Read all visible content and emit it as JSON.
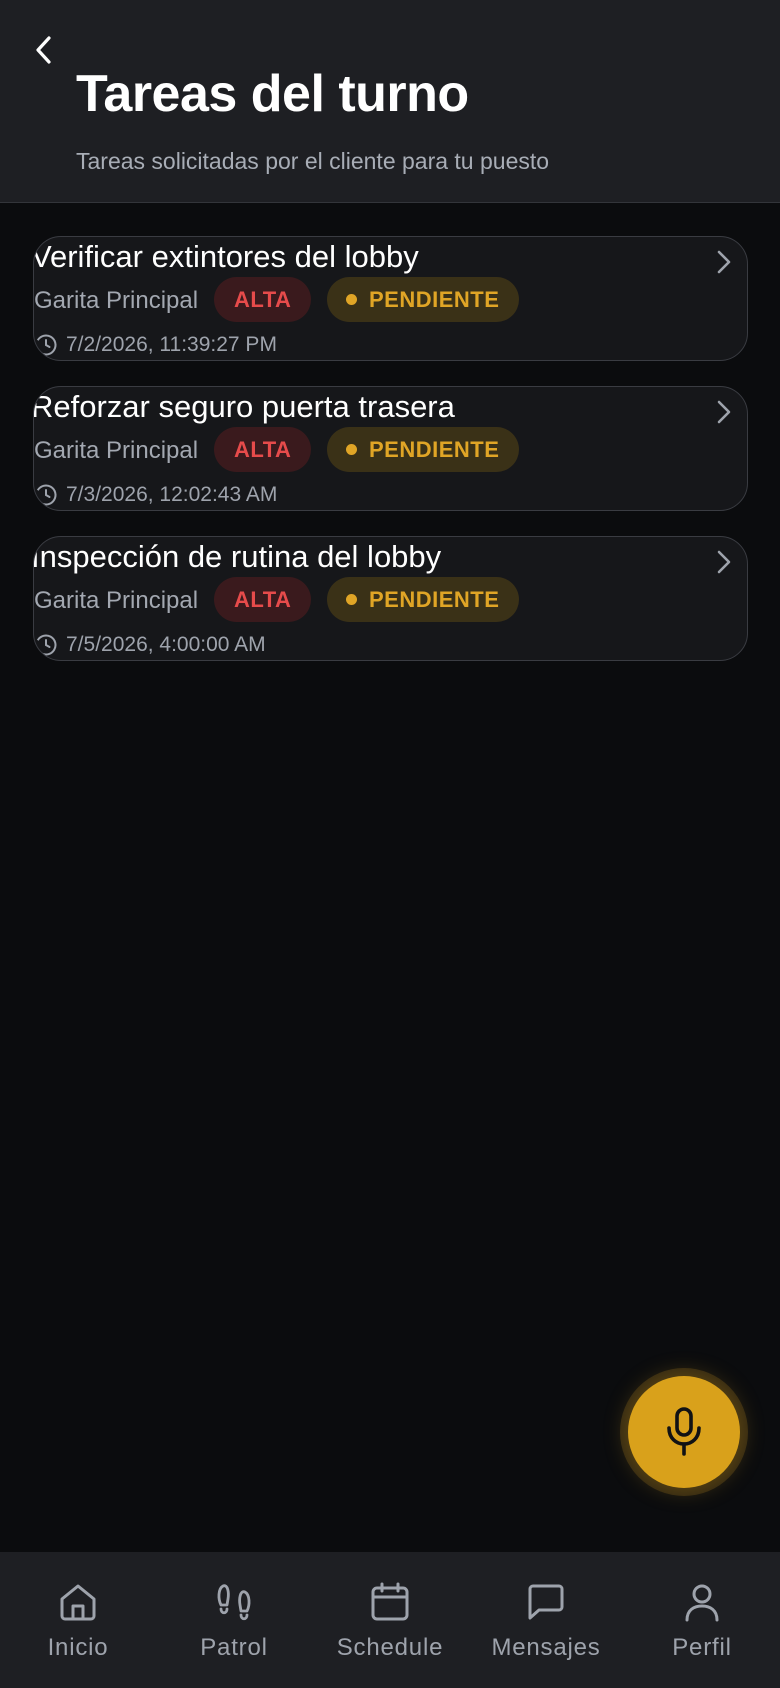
{
  "header": {
    "title": "Tareas del turno",
    "subtitle": "Tareas solicitadas por el cliente para tu puesto"
  },
  "tasks": [
    {
      "title": "Verificar extintores del lobby",
      "location": "Garita Principal",
      "priority": "ALTA",
      "status": "PENDIENTE",
      "datetime": "7/2/2026, 11:39:27 PM"
    },
    {
      "title": "Reforzar seguro puerta trasera",
      "location": "Garita Principal",
      "priority": "ALTA",
      "status": "PENDIENTE",
      "datetime": "7/3/2026, 12:02:43 AM"
    },
    {
      "title": "Inspección de rutina del lobby",
      "location": "Garita Principal",
      "priority": "ALTA",
      "status": "PENDIENTE",
      "datetime": "7/5/2026, 4:00:00 AM"
    }
  ],
  "fab": {
    "icon": "microphone-icon"
  },
  "nav": {
    "items": [
      {
        "label": "Inicio",
        "icon": "home-icon"
      },
      {
        "label": "Patrol",
        "icon": "footprints-icon"
      },
      {
        "label": "Schedule",
        "icon": "calendar-icon"
      },
      {
        "label": "Mensajes",
        "icon": "message-icon"
      },
      {
        "label": "Perfil",
        "icon": "user-icon"
      }
    ]
  },
  "colors": {
    "background": "#0b0c0e",
    "header": "#1e1f23",
    "card": "#16171a",
    "priority_text": "#e64b4b",
    "priority_bg": "#3a1a1d",
    "status_text": "#e0a526",
    "status_bg": "#3a3117",
    "accent": "#d9a11b"
  }
}
